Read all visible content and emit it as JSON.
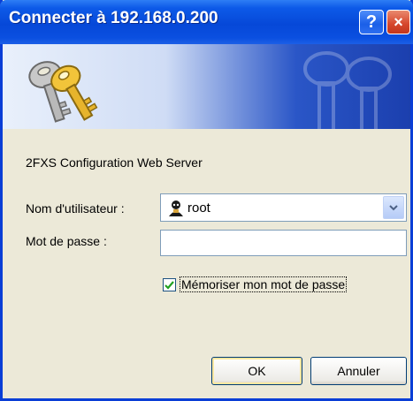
{
  "window": {
    "title": "Connecter à 192.168.0.200",
    "help_glyph": "?",
    "close_glyph": "×"
  },
  "banner": {
    "icon": "keys-icon"
  },
  "dialog": {
    "server_message": "2FXS Configuration Web Server",
    "username_label": "Nom d'utilisateur :",
    "username_value": "root",
    "password_label": "Mot de passe :",
    "password_value": "",
    "remember_label": "Mémoriser mon mot de passe",
    "remember_checked": true
  },
  "buttons": {
    "ok_label": "OK",
    "cancel_label": "Annuler"
  },
  "colors": {
    "titlebar": "#0a4fe0",
    "dialog_bg": "#ece9d8",
    "close_button": "#d6462b"
  }
}
